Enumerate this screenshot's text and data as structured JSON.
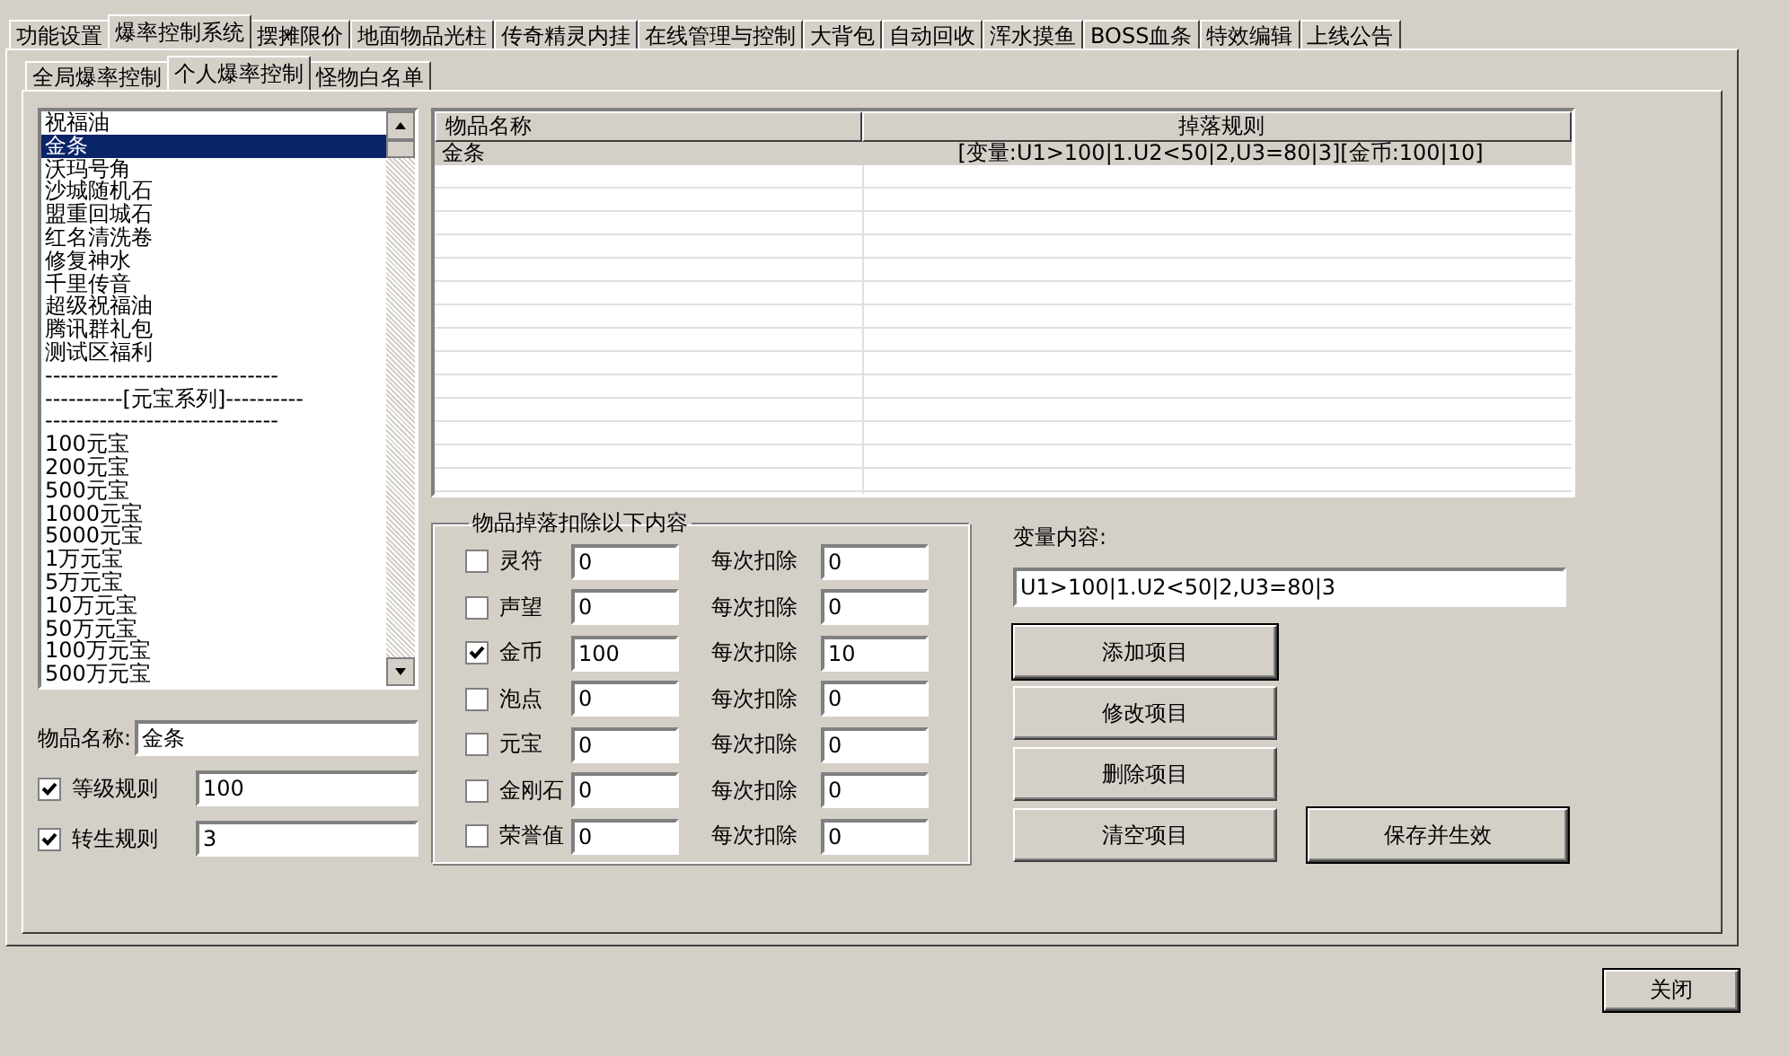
{
  "tabs": [
    {
      "label": "功能设置",
      "selected": false
    },
    {
      "label": "爆率控制系统",
      "selected": true
    },
    {
      "label": "摆摊限价",
      "selected": false
    },
    {
      "label": "地面物品光柱",
      "selected": false
    },
    {
      "label": "传奇精灵内挂",
      "selected": false
    },
    {
      "label": "在线管理与控制",
      "selected": false
    },
    {
      "label": "大背包",
      "selected": false
    },
    {
      "label": "自动回收",
      "selected": false
    },
    {
      "label": "浑水摸鱼",
      "selected": false
    },
    {
      "label": "BOSS血条",
      "selected": false
    },
    {
      "label": "特效编辑",
      "selected": false
    },
    {
      "label": "上线公告",
      "selected": false
    }
  ],
  "subtabs": [
    {
      "label": "全局爆率控制",
      "selected": false
    },
    {
      "label": "个人爆率控制",
      "selected": true
    },
    {
      "label": "怪物白名单",
      "selected": false
    }
  ],
  "item_list": [
    {
      "text": "祝福油",
      "selected": false
    },
    {
      "text": "金条",
      "selected": true
    },
    {
      "text": "沃玛号角",
      "selected": false
    },
    {
      "text": "沙城随机石",
      "selected": false
    },
    {
      "text": "盟重回城石",
      "selected": false
    },
    {
      "text": "红名清洗卷",
      "selected": false
    },
    {
      "text": "修复神水",
      "selected": false
    },
    {
      "text": "千里传音",
      "selected": false
    },
    {
      "text": "超级祝福油",
      "selected": false
    },
    {
      "text": "腾讯群礼包",
      "selected": false
    },
    {
      "text": "测试区福利",
      "selected": false
    },
    {
      "text": "------------------------------",
      "selected": false
    },
    {
      "text": "----------[元宝系列]----------",
      "selected": false
    },
    {
      "text": "------------------------------",
      "selected": false
    },
    {
      "text": "100元宝",
      "selected": false
    },
    {
      "text": "200元宝",
      "selected": false
    },
    {
      "text": "500元宝",
      "selected": false
    },
    {
      "text": "1000元宝",
      "selected": false
    },
    {
      "text": "5000元宝",
      "selected": false
    },
    {
      "text": "1万元宝",
      "selected": false
    },
    {
      "text": "5万元宝",
      "selected": false
    },
    {
      "text": "10万元宝",
      "selected": false
    },
    {
      "text": "50万元宝",
      "selected": false
    },
    {
      "text": "100万元宝",
      "selected": false
    },
    {
      "text": "500万元宝",
      "selected": false
    }
  ],
  "item_name": {
    "label": "物品名称:",
    "value": "金条"
  },
  "rules": [
    {
      "label": "等级规则",
      "checked": true,
      "value": "100"
    },
    {
      "label": "转生规则",
      "checked": true,
      "value": "3"
    }
  ],
  "table": {
    "columns": [
      "物品名称",
      "掉落规则"
    ],
    "rows": [
      [
        "金条",
        "[变量:U1>100|1.U2<50|2,U3=80|3][金币:100|10]"
      ]
    ]
  },
  "deduct_group": {
    "title": "物品掉落扣除以下内容",
    "rows": [
      {
        "label": "灵符",
        "checked": false,
        "value": "0",
        "per_label": "每次扣除",
        "per_value": "0"
      },
      {
        "label": "声望",
        "checked": false,
        "value": "0",
        "per_label": "每次扣除",
        "per_value": "0"
      },
      {
        "label": "金币",
        "checked": true,
        "value": "100",
        "per_label": "每次扣除",
        "per_value": "10"
      },
      {
        "label": "泡点",
        "checked": false,
        "value": "0",
        "per_label": "每次扣除",
        "per_value": "0"
      },
      {
        "label": "元宝",
        "checked": false,
        "value": "0",
        "per_label": "每次扣除",
        "per_value": "0"
      },
      {
        "label": "金刚石",
        "checked": false,
        "value": "0",
        "per_label": "每次扣除",
        "per_value": "0"
      },
      {
        "label": "荣誉值",
        "checked": false,
        "value": "0",
        "per_label": "每次扣除",
        "per_value": "0"
      }
    ]
  },
  "variable": {
    "label": "变量内容:",
    "value": "U1>100|1.U2<50|2,U3=80|3"
  },
  "buttons": [
    "添加项目",
    "修改项目",
    "删除项目",
    "清空项目"
  ],
  "save_button": "保存并生效",
  "close_button": "关闭"
}
